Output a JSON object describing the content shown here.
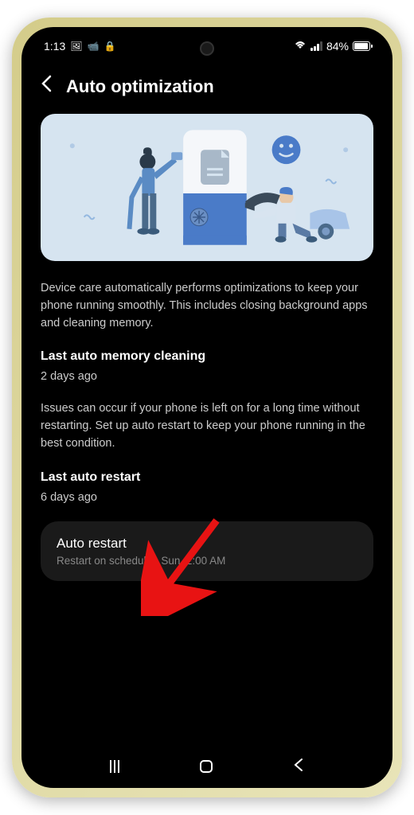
{
  "statusBar": {
    "time": "1:13",
    "batteryPercent": "84%"
  },
  "header": {
    "title": "Auto optimization"
  },
  "description": "Device care automatically performs optimizations to keep your phone running smoothly. This includes closing background apps and cleaning memory.",
  "sections": {
    "memoryCleaning": {
      "title": "Last auto memory cleaning",
      "value": "2 days ago"
    },
    "restartInfo": "Issues can occur if your phone is left on for a long time without restarting. Set up auto restart to keep your phone running in the best condition.",
    "lastRestart": {
      "title": "Last auto restart",
      "value": "6 days ago"
    }
  },
  "autoRestartCard": {
    "title": "Auto restart",
    "subtitle": "Restart on schedule : Sun, 2:00 AM"
  }
}
